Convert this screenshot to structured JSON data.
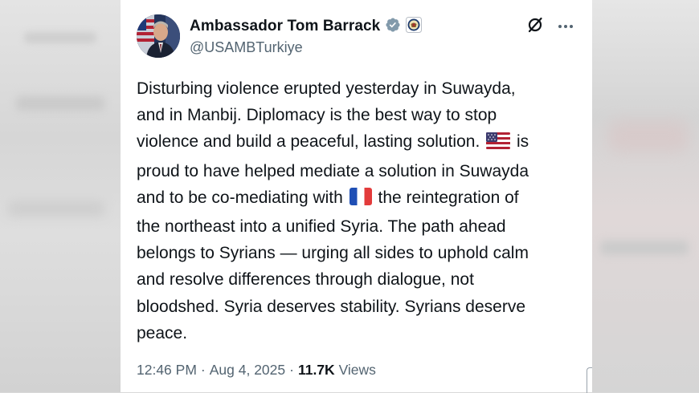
{
  "post": {
    "author_name": "Ambassador Tom Barrack",
    "author_handle": "@USAMBTurkiye",
    "body_lines": [
      {
        "before": "Disturbing violence erupted yesterday in Suwayda,",
        "flag": "",
        "after": ""
      },
      {
        "before": "and in Manbij. Diplomacy is the best way to stop",
        "flag": "",
        "after": ""
      },
      {
        "before": "violence and build a peaceful, lasting solution. ",
        "flag": "us-flag",
        "after": " is"
      },
      {
        "before": "proud to have helped mediate a solution in Suwayda",
        "flag": "",
        "after": ""
      },
      {
        "before": "and to be co-mediating with ",
        "flag": "france-flag",
        "after": " the reintegration of"
      },
      {
        "before": "the northeast into a unified Syria. The path ahead",
        "flag": "",
        "after": ""
      },
      {
        "before": "belongs to Syrians — urging all sides to uphold calm",
        "flag": "",
        "after": ""
      },
      {
        "before": "and resolve differences through dialogue, not",
        "flag": "",
        "after": ""
      },
      {
        "before": "bloodshed. Syria deserves stability. Syrians deserve",
        "flag": "",
        "after": ""
      },
      {
        "before": "peace.",
        "flag": "",
        "after": ""
      }
    ],
    "time": "12:46 PM",
    "date": "Aug 4, 2025",
    "views_count": "11.7K",
    "views_label": "Views",
    "separator": "·"
  },
  "icons": {
    "verified": "verified-badge-icon",
    "affiliation": "state-department-seal-icon",
    "grok": "grok-icon",
    "more": "more-icon"
  },
  "colors": {
    "text": "#0f1419",
    "muted": "#536471",
    "background": "#ffffff"
  }
}
